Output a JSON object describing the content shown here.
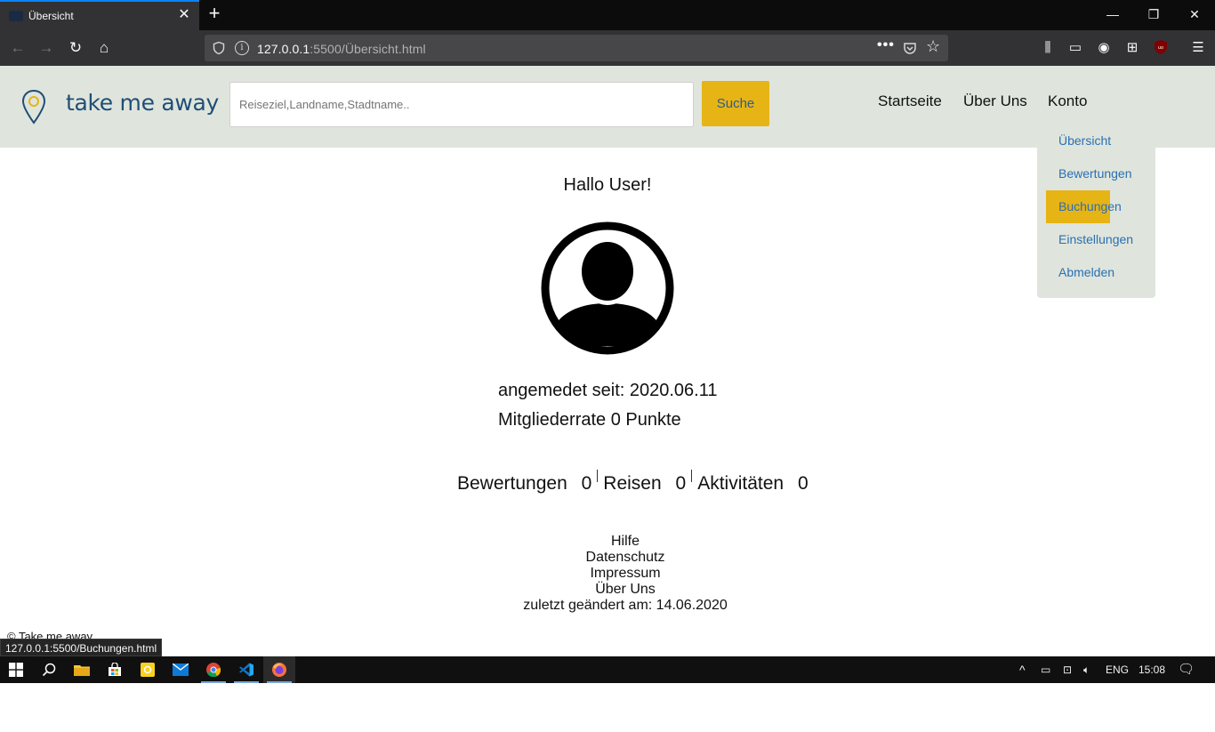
{
  "browser": {
    "tab_title": "Übersicht",
    "url_host": "127.0.0.1",
    "url_path": ":5500/Übersicht.html",
    "status_url": "127.0.0.1:5500/Buchungen.html"
  },
  "header": {
    "logo_text": "take me away",
    "search_placeholder": "Reiseziel,Landname,Stadtname..",
    "search_button": "Suche",
    "nav": [
      {
        "label": "Startseite"
      },
      {
        "label": "Über Uns"
      },
      {
        "label": "Konto"
      }
    ]
  },
  "dropdown": {
    "items": [
      {
        "label": "Übersicht"
      },
      {
        "label": "Bewertungen"
      },
      {
        "label": "Buchungen",
        "active": true
      },
      {
        "label": "Einstellungen"
      },
      {
        "label": "Abmelden"
      }
    ]
  },
  "profile": {
    "greeting": "Hallo User!",
    "member_since": "angemedet seit: 2020.06.11",
    "member_rate": "Mitgliederrate 0 Punkte",
    "stats": [
      {
        "label": "Bewertungen",
        "value": "0"
      },
      {
        "label": "Reisen",
        "value": "0"
      },
      {
        "label": "Aktivitäten",
        "value": "0"
      }
    ]
  },
  "footer": {
    "links": [
      "Hilfe",
      "Datenschutz",
      "Impressum",
      "Über Uns"
    ],
    "last_changed": "zuletzt geändert am: 14.06.2020",
    "copyright": "© Take me away"
  },
  "taskbar": {
    "language": "ENG",
    "time": "15:08"
  },
  "colors": {
    "header_bg": "#dfe5dc",
    "accent": "#e7b416",
    "link": "#2b6fb3",
    "logo": "#1f4e77"
  }
}
